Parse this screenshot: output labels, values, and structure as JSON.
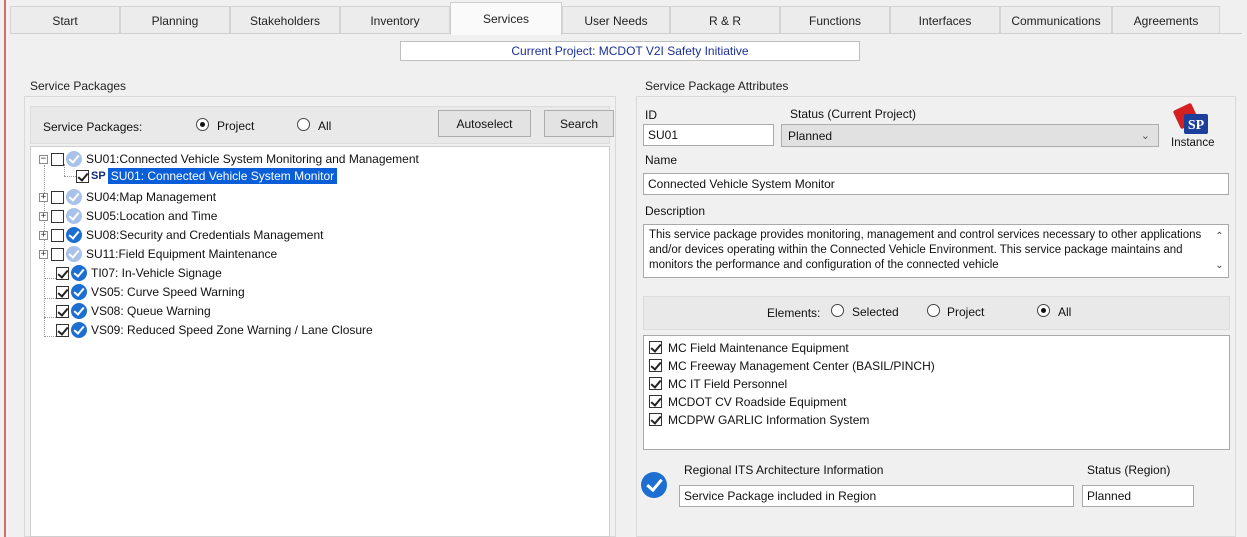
{
  "tabs": [
    {
      "label": "Start"
    },
    {
      "label": "Planning"
    },
    {
      "label": "Stakeholders"
    },
    {
      "label": "Inventory"
    },
    {
      "label": "Services"
    },
    {
      "label": "User Needs"
    },
    {
      "label": "R & R"
    },
    {
      "label": "Functions"
    },
    {
      "label": "Interfaces"
    },
    {
      "label": "Communications"
    },
    {
      "label": "Agreements"
    }
  ],
  "active_tab": "Services",
  "current_project": "Current Project: MCDOT V2I Safety Initiative",
  "service_packages": {
    "title": "Service Packages",
    "filter_label": "Service Packages:",
    "radio_project": "Project",
    "radio_all": "All",
    "selected_radio": "Project",
    "autoselect_label": "Autoselect",
    "search_label": "Search",
    "tree": [
      {
        "label": "SU01:Connected Vehicle System Monitoring and Management",
        "expander": "−",
        "checked": false,
        "icon": "partial-check-icon"
      },
      {
        "prefix": "SP",
        "label": "SU01: Connected Vehicle System Monitor",
        "checked": true,
        "selected": true
      },
      {
        "label": "SU04:Map Management",
        "expander": "+",
        "checked": false,
        "icon": "partial-check-icon"
      },
      {
        "label": "SU05:Location and Time",
        "expander": "+",
        "checked": false,
        "icon": "partial-check-icon"
      },
      {
        "label": "SU08:Security and Credentials Management",
        "expander": "+",
        "checked": false,
        "icon": "check-circle-icon"
      },
      {
        "label": "SU11:Field Equipment Maintenance",
        "expander": "+",
        "checked": false,
        "icon": "partial-check-icon"
      },
      {
        "label": "TI07: In-Vehicle Signage",
        "checked": true,
        "icon": "check-circle-icon"
      },
      {
        "label": "VS05: Curve Speed Warning",
        "checked": true,
        "icon": "check-circle-icon"
      },
      {
        "label": "VS08: Queue Warning",
        "checked": true,
        "icon": "check-circle-icon"
      },
      {
        "label": "VS09: Reduced Speed Zone Warning / Lane Closure",
        "checked": true,
        "icon": "check-circle-icon"
      }
    ]
  },
  "attributes": {
    "title": "Service Package Attributes",
    "id_label": "ID",
    "id_value": "SU01",
    "status_label": "Status (Current Project)",
    "status_value": "Planned",
    "instance_label": "Instance",
    "instance_icon_text": "SP",
    "name_label": "Name",
    "name_value": "Connected Vehicle System Monitor",
    "description_label": "Description",
    "description_value": "This service package provides monitoring, management and control services necessary to other applications and/or devices operating within the Connected Vehicle Environment.  This service package maintains and monitors the performance and configuration of the connected vehicle",
    "elements_label": "Elements:",
    "elements_radio_selected": "Selected",
    "elements_radio_project": "Project",
    "elements_radio_all": "All",
    "elements_selected_radio": "All",
    "elements": [
      {
        "label": "MC Field Maintenance Equipment",
        "checked": true
      },
      {
        "label": "MC Freeway Management Center (BASIL/PINCH)",
        "checked": true
      },
      {
        "label": "MC IT Field Personnel",
        "checked": true
      },
      {
        "label": "MCDOT CV Roadside Equipment",
        "checked": true
      },
      {
        "label": "MCDPW GARLIC Information System",
        "checked": true
      }
    ],
    "regional_label": "Regional ITS Architecture Information",
    "regional_value": "Service Package included in Region",
    "status_region_label": "Status (Region)",
    "status_region_value": "Planned"
  },
  "colors": {
    "accent_blue": "#0a5fd8",
    "project_text": "#1a2f9a",
    "check_icon": "#1c6fd1",
    "instance_red": "#d42020"
  }
}
